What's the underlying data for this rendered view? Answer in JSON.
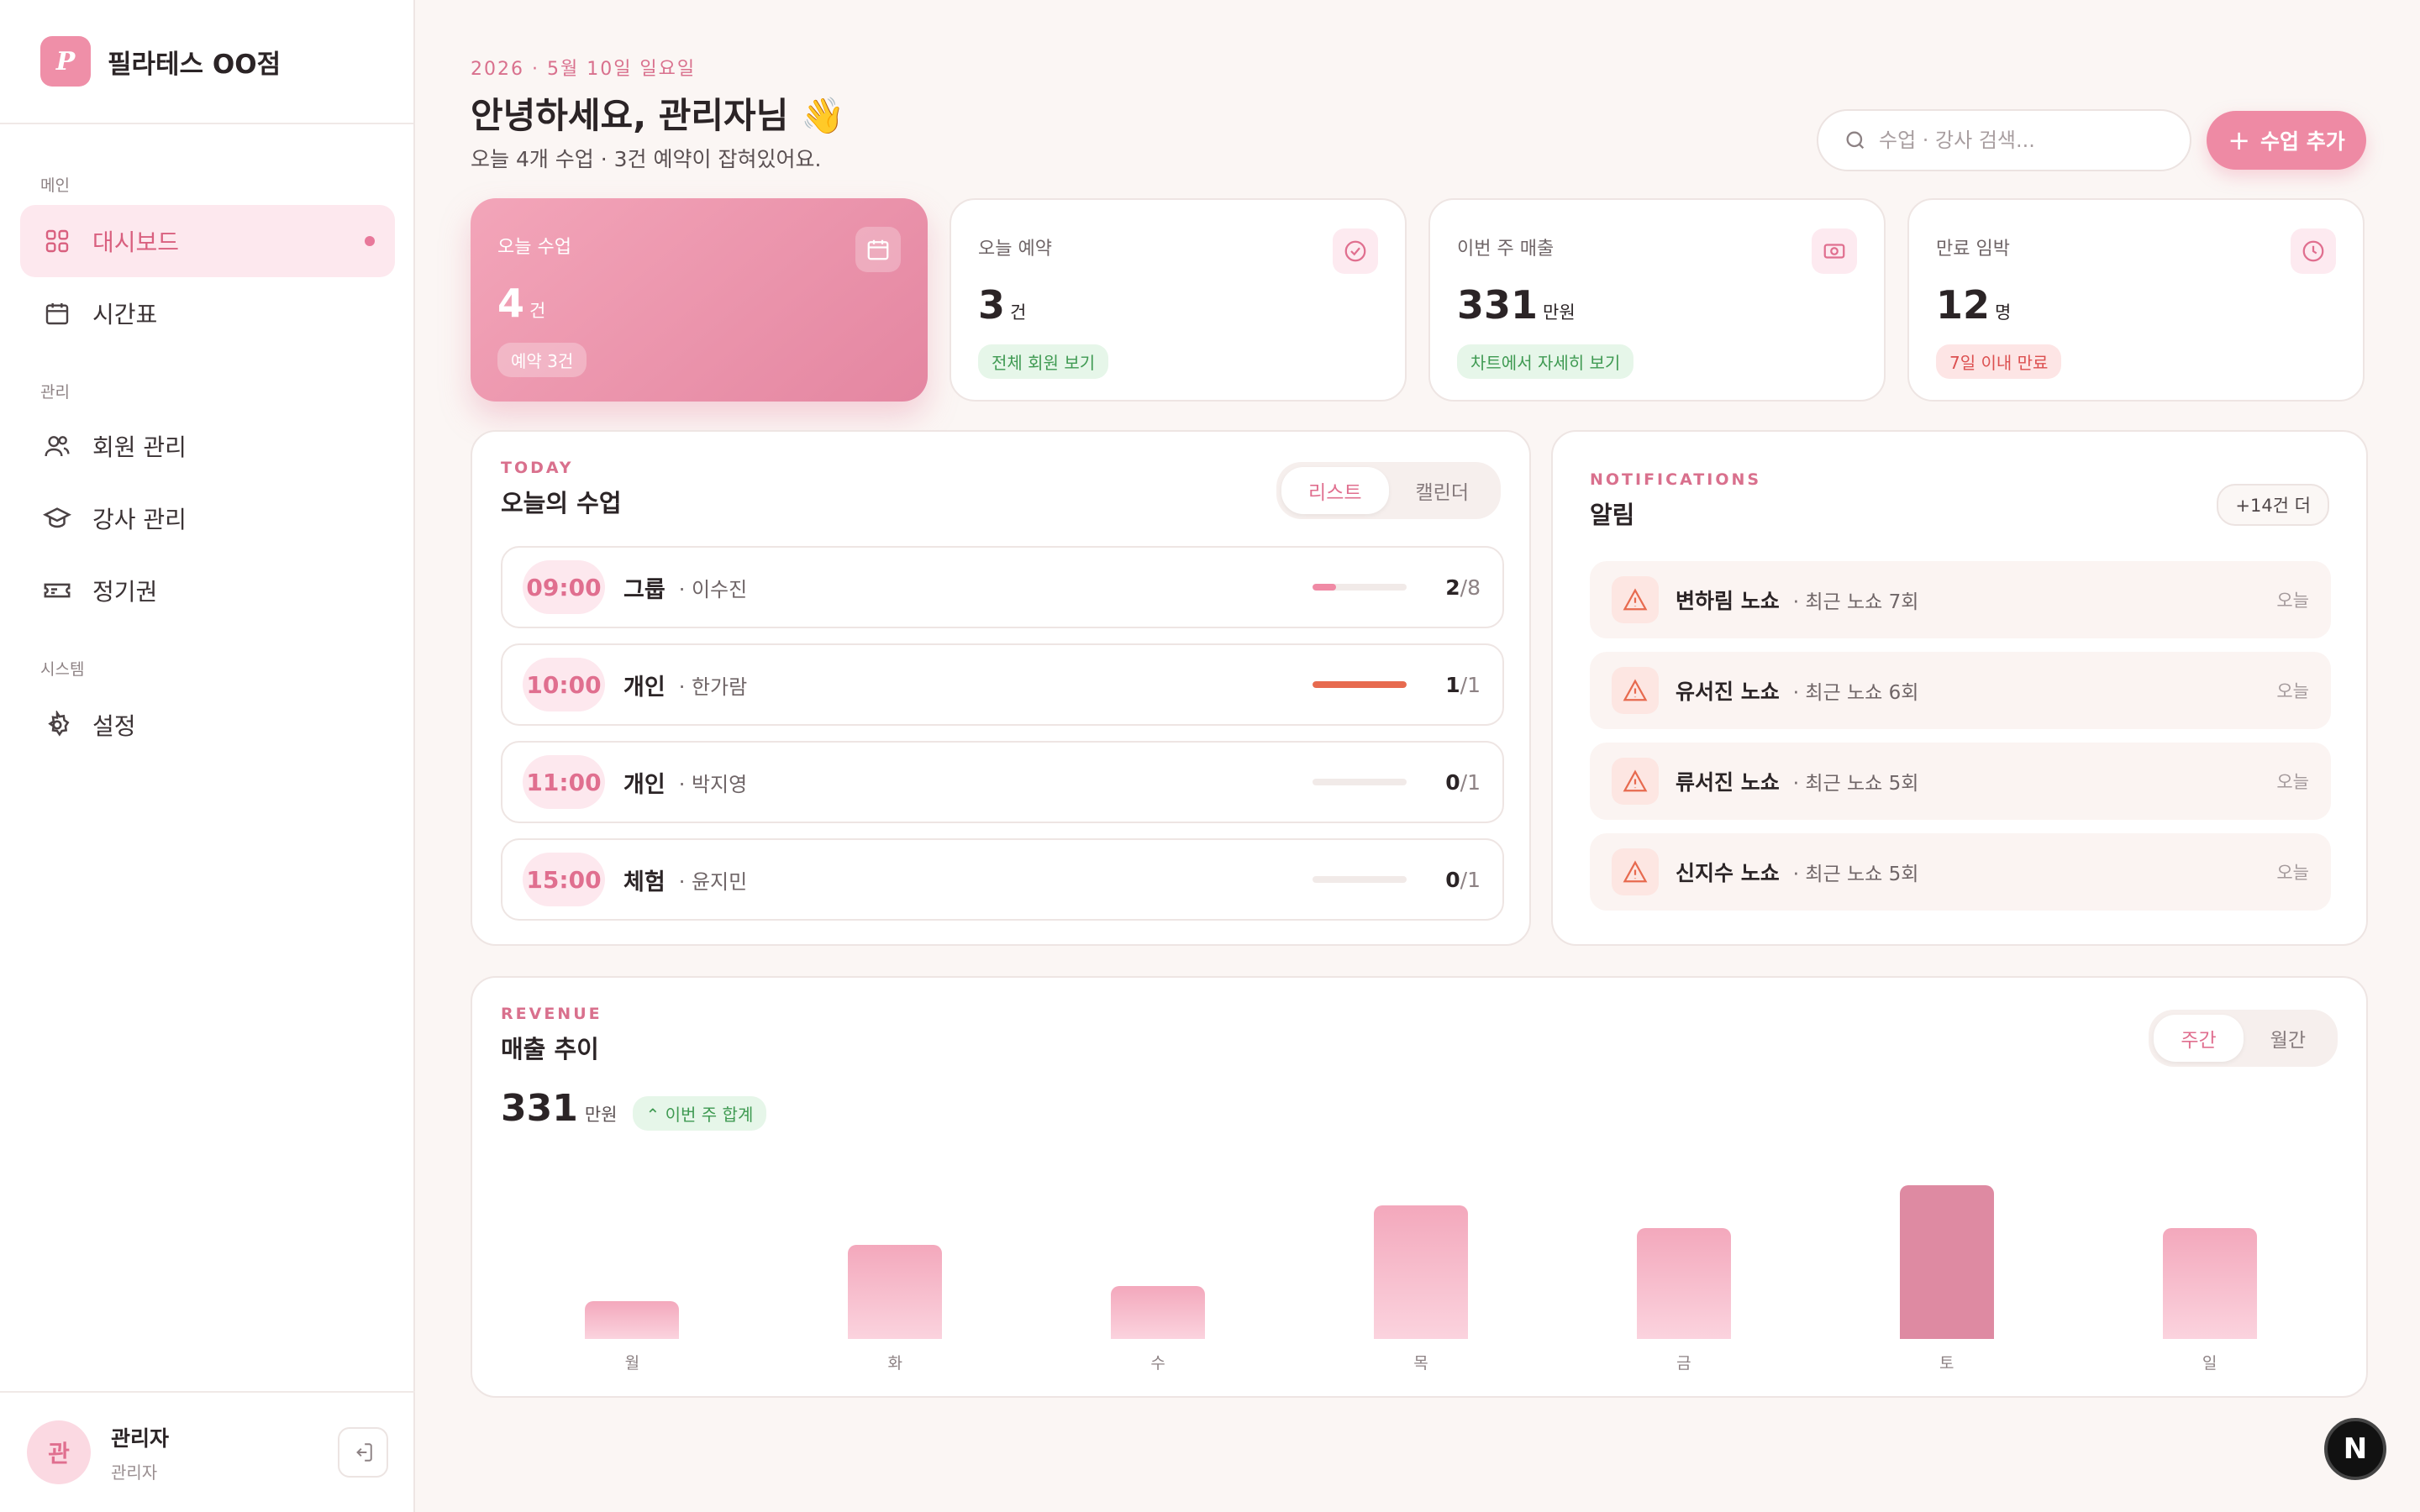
{
  "brand": {
    "logo_letter": "P",
    "name": "필라테스 OO점"
  },
  "sidebar": {
    "sections": [
      {
        "label": "메인",
        "items": [
          {
            "label": "대시보드",
            "icon": "dashboard-grid-icon",
            "active": true
          },
          {
            "label": "시간표",
            "icon": "calendar-icon"
          }
        ]
      },
      {
        "label": "관리",
        "items": [
          {
            "label": "회원 관리",
            "icon": "users-icon"
          },
          {
            "label": "강사 관리",
            "icon": "graduation-cap-icon"
          },
          {
            "label": "정기권",
            "icon": "ticket-icon"
          }
        ]
      },
      {
        "label": "시스템",
        "items": [
          {
            "label": "설정",
            "icon": "gear-icon"
          }
        ]
      }
    ]
  },
  "user": {
    "avatar_letter": "관",
    "name": "관리자",
    "role": "관리자"
  },
  "header": {
    "date": "2026 · 5월 10일 일요일",
    "greeting": "안녕하세요, 관리자님 👋",
    "subtitle": "오늘 4개 수업 · 3건 예약이 잡혀있어요.",
    "search_placeholder": "수업 · 강사 검색...",
    "add_button": "수업 추가"
  },
  "stats": [
    {
      "label": "오늘 수업",
      "value": "4",
      "unit": "건",
      "pill": "예약 3건",
      "icon": "calendar-icon"
    },
    {
      "label": "오늘 예약",
      "value": "3",
      "unit": "건",
      "pill": "전체 회원 보기",
      "icon": "check-circle-icon"
    },
    {
      "label": "이번 주 매출",
      "value": "331",
      "unit": "만원",
      "pill": "차트에서 자세히 보기",
      "icon": "money-icon"
    },
    {
      "label": "만료 임박",
      "value": "12",
      "unit": "명",
      "pill": "7일 이내 만료",
      "icon": "clock-icon"
    }
  ],
  "classes": {
    "eyebrow": "TODAY",
    "title": "오늘의 수업",
    "tabs": [
      "리스트",
      "캘린더"
    ],
    "rows": [
      {
        "time": "09:00",
        "type": "그룹",
        "trainer": "· 이수진",
        "booked": "2",
        "capacity": "/8",
        "fill": 0.25,
        "color": "#f08aa5"
      },
      {
        "time": "10:00",
        "type": "개인",
        "trainer": "· 한가람",
        "booked": "1",
        "capacity": "/1",
        "fill": 1.0,
        "color": "#e76a4f"
      },
      {
        "time": "11:00",
        "type": "개인",
        "trainer": "· 박지영",
        "booked": "0",
        "capacity": "/1",
        "fill": 0,
        "color": "#f08aa5"
      },
      {
        "time": "15:00",
        "type": "체험",
        "trainer": "· 윤지민",
        "booked": "0",
        "capacity": "/1",
        "fill": 0,
        "color": "#f08aa5"
      }
    ]
  },
  "notifications": {
    "eyebrow": "NOTIFICATIONS",
    "title": "알림",
    "more": "+14건 더",
    "items": [
      {
        "name": "변하림 노쇼",
        "detail": "· 최근 노쇼 7회",
        "when": "오늘"
      },
      {
        "name": "유서진 노쇼",
        "detail": "· 최근 노쇼 6회",
        "when": "오늘"
      },
      {
        "name": "류서진 노쇼",
        "detail": "· 최근 노쇼 5회",
        "when": "오늘"
      },
      {
        "name": "신지수 노쇼",
        "detail": "· 최근 노쇼 5회",
        "when": "오늘"
      }
    ]
  },
  "revenue": {
    "eyebrow": "REVENUE",
    "title": "매출 추이",
    "total": "331",
    "unit": "만원",
    "badge": "이번 주 합계",
    "tabs": [
      "주간",
      "월간"
    ]
  },
  "chart_data": {
    "type": "bar",
    "categories": [
      "월",
      "화",
      "수",
      "목",
      "금",
      "토",
      "일"
    ],
    "values": [
      25,
      62,
      35,
      88,
      73,
      101,
      73
    ],
    "highlight_index": 5,
    "ylim": [
      0,
      105
    ],
    "grid": false
  },
  "fab_letter": "N",
  "colors": {
    "accent": "#ee8aa4",
    "accent_dark": "#e06f8f",
    "bar": "#f3a8bc",
    "bar_highlight": "#de8aa2"
  }
}
